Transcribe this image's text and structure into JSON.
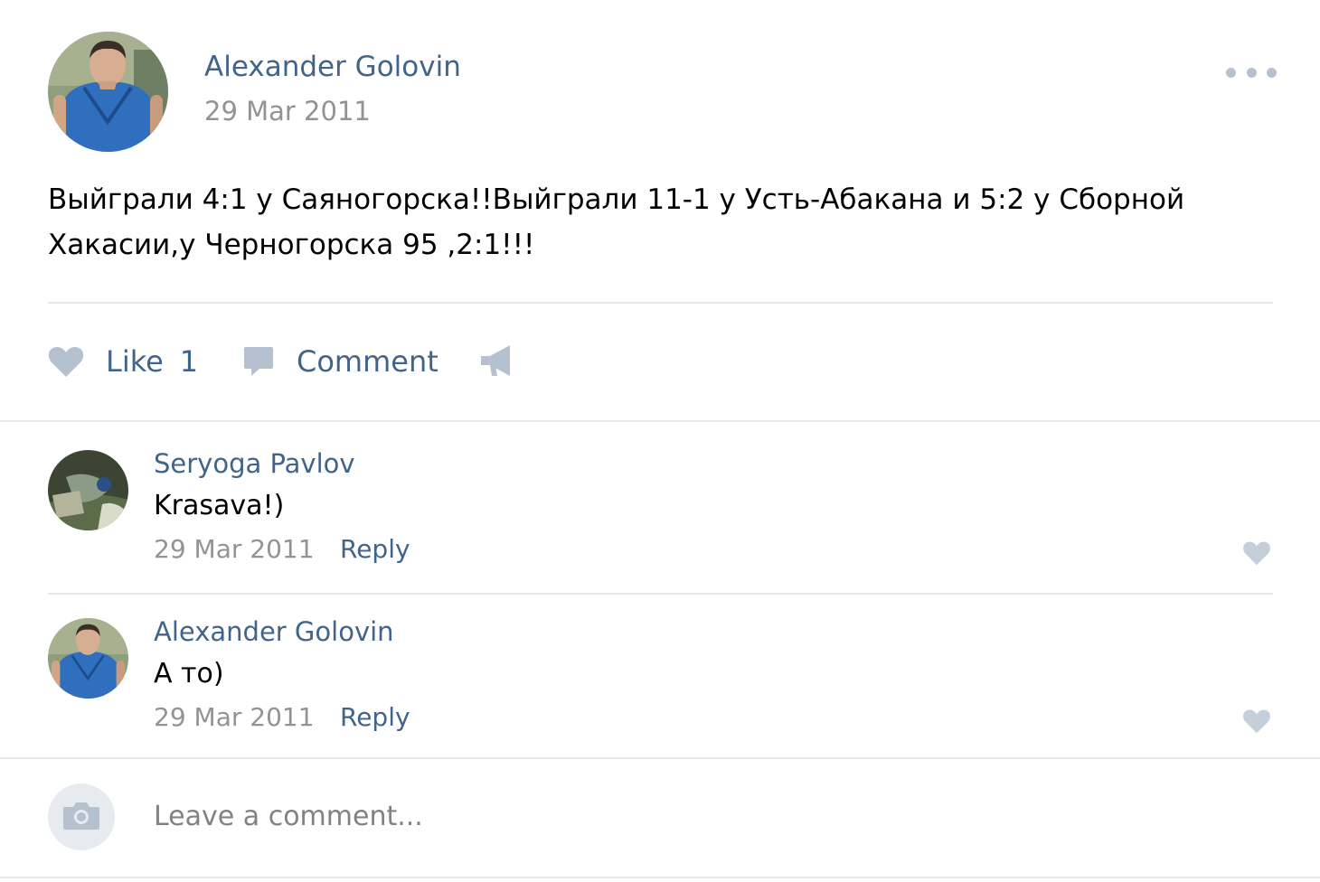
{
  "post": {
    "author": "Alexander Golovin",
    "date": "29 Mar 2011",
    "text": "Выйграли 4:1 у Саяногорска!!Выйграли 11-1 у Усть-Абакана и 5:2 у Сборной Хакасии,у Черногорска 95 ,2:1!!!",
    "actions": {
      "like_label": "Like",
      "like_count": "1",
      "comment_label": "Comment"
    }
  },
  "comments": [
    {
      "author": "Seryoga Pavlov",
      "text": "Krasava!)",
      "date": "29 Mar 2011",
      "reply_label": "Reply"
    },
    {
      "author": "Alexander Golovin",
      "text": "А то)",
      "date": "29 Mar 2011",
      "reply_label": "Reply"
    }
  ],
  "comment_box": {
    "placeholder": "Leave a comment..."
  },
  "icons": {
    "more": "more-horizontal-icon",
    "like": "heart-icon",
    "comment": "speech-bubble-icon",
    "share": "megaphone-icon",
    "camera": "camera-icon"
  },
  "colors": {
    "link": "#42648b",
    "muted": "#939393",
    "icon": "#b5c1cf",
    "divider": "#e7e8ec"
  }
}
